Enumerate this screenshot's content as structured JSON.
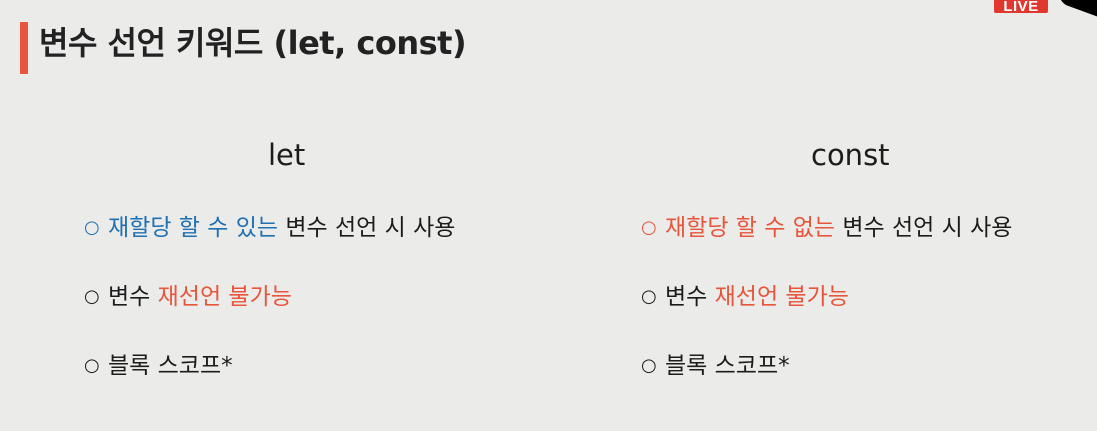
{
  "overlay": {
    "live_badge": "LIVE",
    "colors": {
      "live": "#e0382f",
      "accent_bar": "#e8553a"
    }
  },
  "slide": {
    "title": "변수 선언 키워드 (let, const)",
    "colors": {
      "blue_highlight": "#1f70b3",
      "red_highlight": "#e8553a",
      "text": "#1c1c1c",
      "background": "#ebebea"
    },
    "bullet_marker": "○",
    "let": {
      "header": "let",
      "bullets": [
        {
          "highlight": "재할당 할 수 있는",
          "highlight_color": "blue",
          "rest": " 변수 선언 시 사용"
        },
        {
          "prefix": "변수 ",
          "highlight": "재선언 불가능",
          "highlight_color": "red"
        },
        {
          "text": "블록 스코프*"
        }
      ]
    },
    "const": {
      "header": "const",
      "bullets": [
        {
          "highlight": "재할당 할 수 없는",
          "highlight_color": "red",
          "rest": " 변수 선언 시 사용"
        },
        {
          "prefix": "변수 ",
          "highlight": "재선언 불가능",
          "highlight_color": "red"
        },
        {
          "text": "블록 스코프*"
        }
      ]
    }
  }
}
